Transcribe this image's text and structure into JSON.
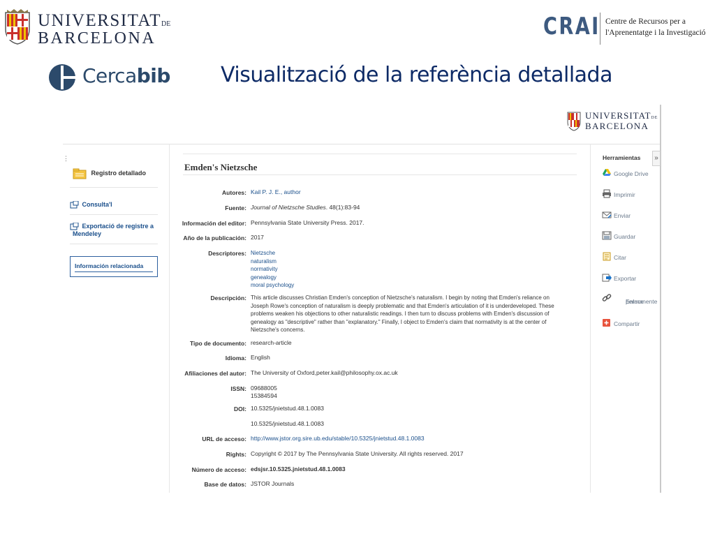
{
  "header": {
    "ub_logo": {
      "line1": "UNIVERSITAT",
      "line1_suffix": "DE",
      "line2": "BARCELONA"
    },
    "crai_logo": {
      "mark": "CRAI",
      "line1": "Centre de Recursos per a",
      "line2": "l'Aprenentatge i la Investigació"
    },
    "cercabib_logo": {
      "text_light": "Cerca",
      "text_bold": "bib"
    },
    "slide_title": "Visualització de la referència detallada",
    "brand_color": "#0d2a66"
  },
  "screenshot": {
    "ub_logo_small": {
      "line1": "UNIVERSITAT",
      "line1_suffix": "DE",
      "line2": "BARCELONA"
    },
    "left_panel": {
      "detailed_record": "Registro detallado",
      "consulta": "Consulta'l",
      "export_line1": "Exportació de registre a",
      "export_line2": "Mendeley",
      "related_info": "Información relacionada"
    },
    "record": {
      "title": "Emden's Nietzsche",
      "fields": {
        "authors": {
          "label": "Autores:",
          "value": "Kail P. J. E., author"
        },
        "source": {
          "label": "Fuente:",
          "journal": "Journal of Nietzsche Studies",
          "rest": ". 48(1):83-94"
        },
        "publisher": {
          "label": "Información del editor:",
          "value": "Pennsylvania State University Press. 2017."
        },
        "year": {
          "label": "Año de la publicación:",
          "value": "2017"
        },
        "descriptors": {
          "label": "Descriptores:",
          "values": [
            "Nietzsche",
            "naturalism",
            "normativity",
            "genealogy",
            "moral psychology"
          ]
        },
        "description": {
          "label": "Descripción:",
          "lines": [
            "This article discusses Christian Emden's conception of Nietzsche's naturalism. I begin by noting that Emden's reliance on",
            "Joseph Rowe's conception of naturalism is deeply problematic and that Emden's articulation of it is underdeveloped. These",
            "problems weaken his objections to other naturalistic readings. I then turn to discuss problems with Emden's discussion of",
            "genealogy as \"descriptive\" rather than \"explanatory.\" Finally, I object to Emden's claim that normativity is at the center of",
            "Nietzsche's concerns."
          ]
        },
        "doc_type": {
          "label": "Tipo de documento:",
          "value": "research-article"
        },
        "language": {
          "label": "Idioma:",
          "value": "English"
        },
        "affiliations": {
          "label": "Afiliaciones del autor:",
          "value": "The University of Oxford,peter.kail@philosophy.ox.ac.uk"
        },
        "issn": {
          "label": "ISSN:",
          "values": [
            "09688005",
            "15384594"
          ]
        },
        "doi": {
          "label": "DOI:",
          "values": [
            "10.5325/jnietstud.48.1.0083",
            "10.5325/jnietstud.48.1.0083"
          ]
        },
        "url": {
          "label": "URL de acceso:",
          "value": "http://www.jstor.org.sire.ub.edu/stable/10.5325/jnietstud.48.1.0083"
        },
        "rights": {
          "label": "Rights:",
          "value": "Copyright © 2017 by The Pennsylvania State University. All rights reserved. 2017"
        },
        "accession": {
          "label": "Número de acceso:",
          "value": "edsjsr.10.5325.jnietstud.48.1.0083"
        },
        "database": {
          "label": "Base de datos:",
          "value": "JSTOR Journals"
        }
      }
    },
    "tools": {
      "title": "Herramientas",
      "toggle": "»",
      "items": {
        "google_drive": "Google Drive",
        "print": "Imprimir",
        "email": "Enviar",
        "save": "Guardar",
        "cite": "Citar",
        "export": "Exportar",
        "permalink_line1": "Enlace",
        "permalink_line2": "permanente",
        "share": "Compartir"
      }
    },
    "colors": {
      "link": "#1a4f8b",
      "tool_text": "#6b7a8c",
      "share_icon": "#e8533c"
    }
  }
}
